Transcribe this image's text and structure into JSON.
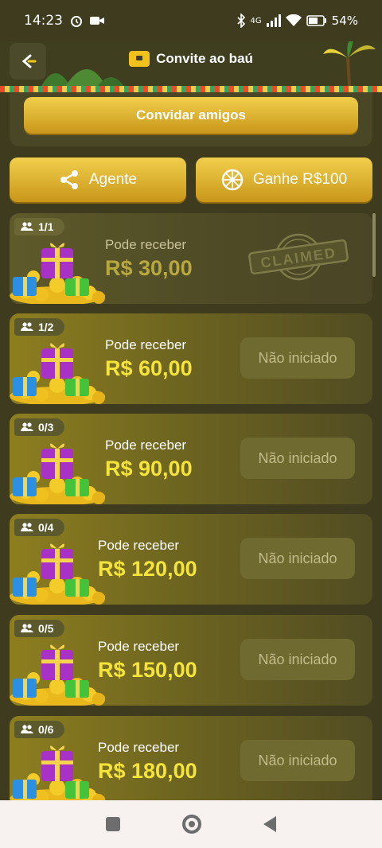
{
  "status_bar": {
    "time": "14:23",
    "network": "4G",
    "battery": "54%"
  },
  "header": {
    "title": "Convite ao baú"
  },
  "invite_button": {
    "label": "Convidar amigos"
  },
  "agent_button": {
    "label": "Agente"
  },
  "earn_button": {
    "label": "Ganhe R$100"
  },
  "cards": [
    {
      "count": "1/1",
      "label": "Pode receber",
      "amount": "R$ 30,00",
      "status": "CLAIMED"
    },
    {
      "count": "1/2",
      "label": "Pode receber",
      "amount": "R$ 60,00",
      "status": "Não iniciado"
    },
    {
      "count": "0/3",
      "label": "Pode receber",
      "amount": "R$ 90,00",
      "status": "Não iniciado"
    },
    {
      "count": "0/4",
      "label": "Pode receber",
      "amount": "R$ 120,00",
      "status": "Não iniciado"
    },
    {
      "count": "0/5",
      "label": "Pode receber",
      "amount": "R$ 150,00",
      "status": "Não iniciado"
    },
    {
      "count": "0/6",
      "label": "Pode receber",
      "amount": "R$ 180,00",
      "status": "Não iniciado"
    }
  ],
  "colors": {
    "background": "#3e3b1e",
    "gold": "#f1cf4b",
    "amount_yellow": "#f5e43a"
  }
}
